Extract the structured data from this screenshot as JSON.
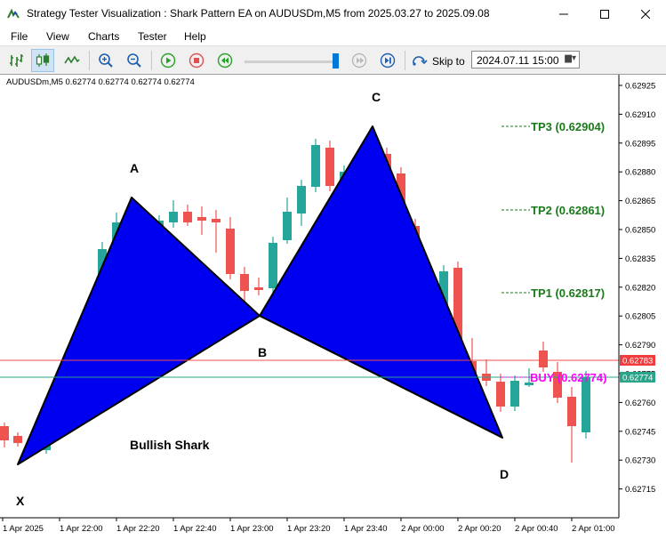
{
  "window": {
    "title": "Strategy Tester Visualization : Shark Pattern EA on AUDUSDm,M5 from 2025.03.27 to 2025.09.08",
    "minimize_icon": "minimize-icon",
    "maximize_icon": "maximize-icon",
    "close_icon": "close-icon"
  },
  "menu": [
    "File",
    "View",
    "Charts",
    "Tester",
    "Help"
  ],
  "toolbar": {
    "skip_to_label": "Skip to",
    "skip_to_value": "2024.07.11 15:00",
    "icons": [
      "bar-chart-icon",
      "candlestick-chart-icon",
      "line-chart-icon",
      "zoom-in-icon",
      "zoom-out-icon",
      "play-icon",
      "stop-icon",
      "rewind-icon",
      "step-icon",
      "skip-forward-icon",
      "skip-to-icon",
      "calendar-dropdown-icon"
    ],
    "speed": 0.95
  },
  "chart": {
    "symbol_info": "AUDUSDm,M5  0.62774 0.62774 0.62774 0.62774",
    "pattern_name": "Bullish Shark",
    "point_labels": {
      "X": "X",
      "A": "A",
      "B": "B",
      "C": "C",
      "D": "D"
    },
    "tp_labels": [
      {
        "text": "TP3 (0.62904)",
        "price": 0.62904
      },
      {
        "text": "TP2 (0.62861)",
        "price": 0.62861
      },
      {
        "text": "TP1 (0.62817)",
        "price": 0.62817
      }
    ],
    "buy_label": {
      "text": "BUY (0.62774)",
      "price": 0.62774
    },
    "price_ticks": [
      "0.62925",
      "0.62910",
      "0.62895",
      "0.62880",
      "0.62865",
      "0.62850",
      "0.62835",
      "0.62820",
      "0.62805",
      "0.62790",
      "0.62775",
      "0.62760",
      "0.62745",
      "0.62730",
      "0.62715"
    ],
    "time_ticks": [
      "1 Apr 2025",
      "1 Apr 22:00",
      "1 Apr 22:20",
      "1 Apr 22:40",
      "1 Apr 23:00",
      "1 Apr 23:20",
      "1 Apr 23:40",
      "2 Apr 00:00",
      "2 Apr 00:20",
      "2 Apr 00:40",
      "2 Apr 01:00"
    ],
    "price_tags": [
      {
        "text": "0.62783",
        "color": "#f03c3c"
      },
      {
        "text": "0.62774",
        "color": "#2aa58a"
      }
    ],
    "colors": {
      "bull": "#26a69a",
      "bear": "#ef5350",
      "triangle": "#0000f0",
      "tp": "#1a7a1a",
      "buy": "#ff00ff",
      "ask_line": "#f05050",
      "bid_line": "#2aa58a"
    }
  }
}
